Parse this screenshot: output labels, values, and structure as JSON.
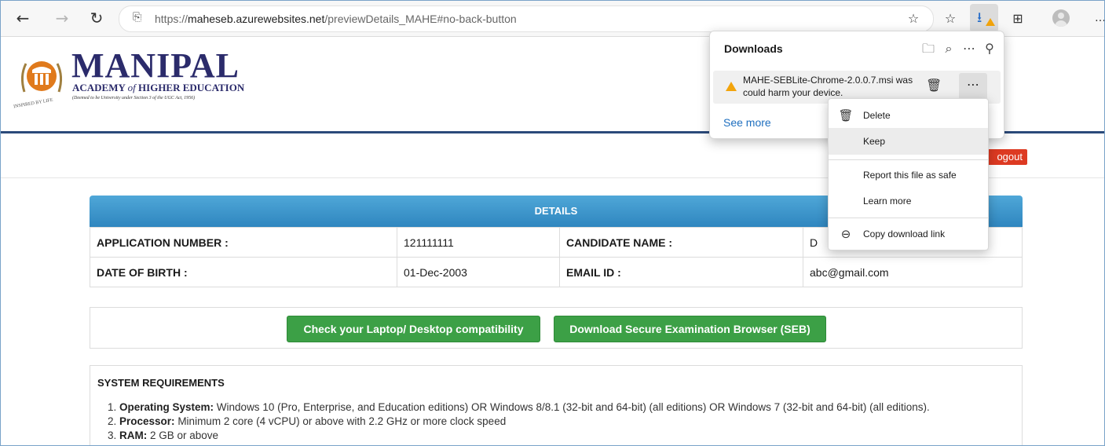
{
  "browser": {
    "url_protocol": "https://",
    "url_host": "maheseb.azurewebsites.net",
    "url_path": "/previewDetails_MAHE#no-back-button",
    "icons": {
      "back": "←",
      "forward": "→",
      "refresh": "↻",
      "lock": "🔒",
      "favorite_add": "☆",
      "favorites": "☆",
      "download": "⭳",
      "collections": "⊞",
      "more": "…"
    }
  },
  "header": {
    "logo_title": "MANIPAL",
    "logo_sub_1": "ACADEMY ",
    "logo_sub_of": "of",
    "logo_sub_2": " HIGHER EDUCATION",
    "logo_note": "(Deemed to be University under Section 3 of the UGC Act, 1956)",
    "inspired": "INSPIRED BY LIFE",
    "logout_label": "ogout"
  },
  "details": {
    "heading": "DETAILS",
    "rows": [
      {
        "label1": "APPLICATION NUMBER :",
        "value1": "121111111",
        "label2": "CANDIDATE NAME :",
        "value2": "D"
      },
      {
        "label1": "DATE OF BIRTH :",
        "value1": "01-Dec-2003",
        "label2": "EMAIL ID :",
        "value2": "abc@gmail.com"
      }
    ]
  },
  "actions": {
    "check_label": "Check your Laptop/ Desktop compatibility",
    "download_label": "Download Secure Examination Browser (SEB)"
  },
  "requirements": {
    "title": "SYSTEM REQUIREMENTS",
    "items": [
      {
        "num": "1. ",
        "key": "Operating System:",
        "text": " Windows 10 (Pro, Enterprise, and Education editions) OR Windows 8/8.1 (32-bit and 64-bit) (all editions) OR Windows 7 (32-bit and 64-bit) (all editions)."
      },
      {
        "num": "2. ",
        "key": "Processor:",
        "text": " Minimum 2 core (4 vCPU) or above with 2.2 GHz or more clock speed"
      },
      {
        "num": "3. ",
        "key": "RAM:",
        "text": " 2 GB or above"
      }
    ]
  },
  "downloads": {
    "title": "Downloads",
    "file_line1": "MAHE-SEBLite-Chrome-2.0.0.7.msi was",
    "file_line2": "could harm your device.",
    "see_more": "See more",
    "icons": {
      "folder": "🗀",
      "search": "⌕",
      "more": "⋯",
      "pin": "⚲",
      "trash": "🗑",
      "item_more": "⋯"
    }
  },
  "context_menu": {
    "delete": "Delete",
    "keep": "Keep",
    "report": "Report this file as safe",
    "learn": "Learn more",
    "copy_link": "Copy download link",
    "icons": {
      "delete": "🗑",
      "copy_link": "⊖"
    }
  }
}
